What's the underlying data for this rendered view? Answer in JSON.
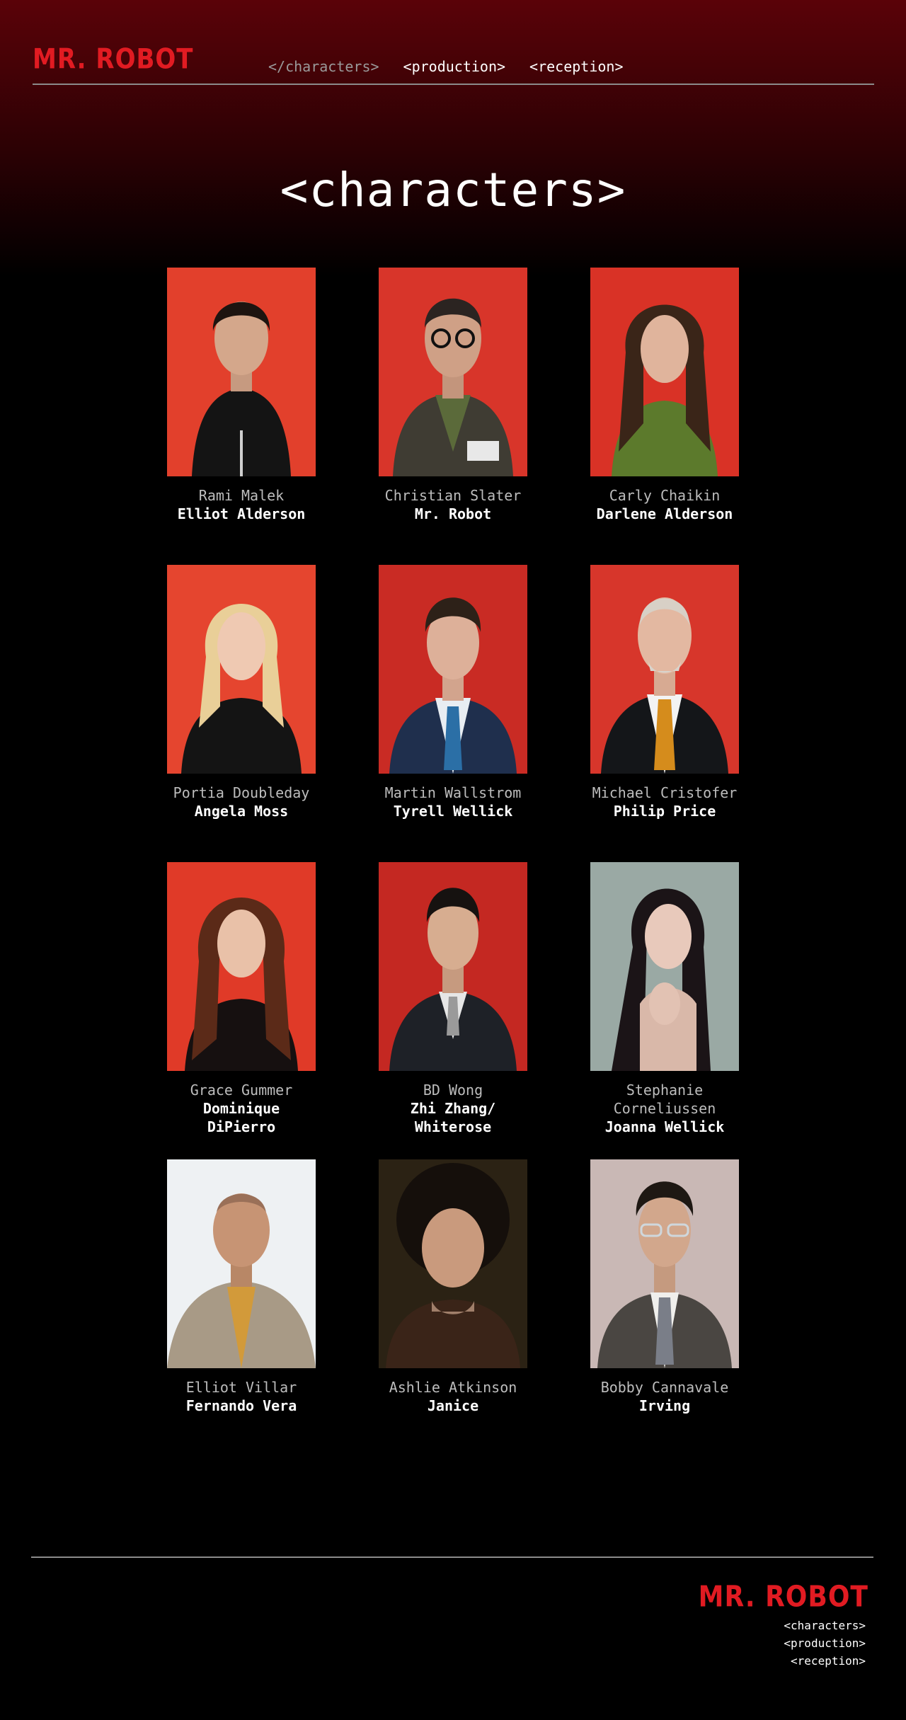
{
  "brand": {
    "logo_text": "MR. ROBOT",
    "color": "#e11b22"
  },
  "nav": {
    "items": [
      {
        "label": "</characters>",
        "active": true
      },
      {
        "label": "<production>",
        "active": false
      },
      {
        "label": "<reception>",
        "active": false
      }
    ]
  },
  "page_title": "<characters>",
  "characters": [
    {
      "actor": "Rami Malek",
      "role": "Elliot Alderson",
      "photo_bg": "#e2402c"
    },
    {
      "actor": "Christian Slater",
      "role": "Mr. Robot",
      "photo_bg": "#d8352a"
    },
    {
      "actor": "Carly Chaikin",
      "role": "Darlene Alderson",
      "photo_bg": "#d93226"
    },
    {
      "actor": "Portia Doubleday",
      "role": "Angela Moss",
      "photo_bg": "#e5452f"
    },
    {
      "actor": "Martin Wallstrom",
      "role": "Tyrell Wellick",
      "photo_bg": "#c92b24"
    },
    {
      "actor": "Michael Cristofer",
      "role": "Philip Price",
      "photo_bg": "#d7362b"
    },
    {
      "actor": "Grace Gummer",
      "role": "Dominique DiPierro",
      "photo_bg": "#e03a28"
    },
    {
      "actor": "BD Wong",
      "role": "Zhi Zhang/ Whiterose",
      "photo_bg": "#c42822"
    },
    {
      "actor": "Stephanie Corneliussen",
      "role": "Joanna Wellick",
      "photo_bg": "#9aa9a4"
    },
    {
      "actor": "Elliot Villar",
      "role": "Fernando Vera",
      "photo_bg": "#eef1f3"
    },
    {
      "actor": "Ashlie Atkinson",
      "role": "Janice",
      "photo_bg": "#2b2214"
    },
    {
      "actor": "Bobby Cannavale",
      "role": "Irving",
      "photo_bg": "#c9b8b5"
    }
  ],
  "footer": {
    "logo_text": "MR. ROBOT",
    "links": [
      "<characters>",
      "<production>",
      "<reception>"
    ]
  }
}
